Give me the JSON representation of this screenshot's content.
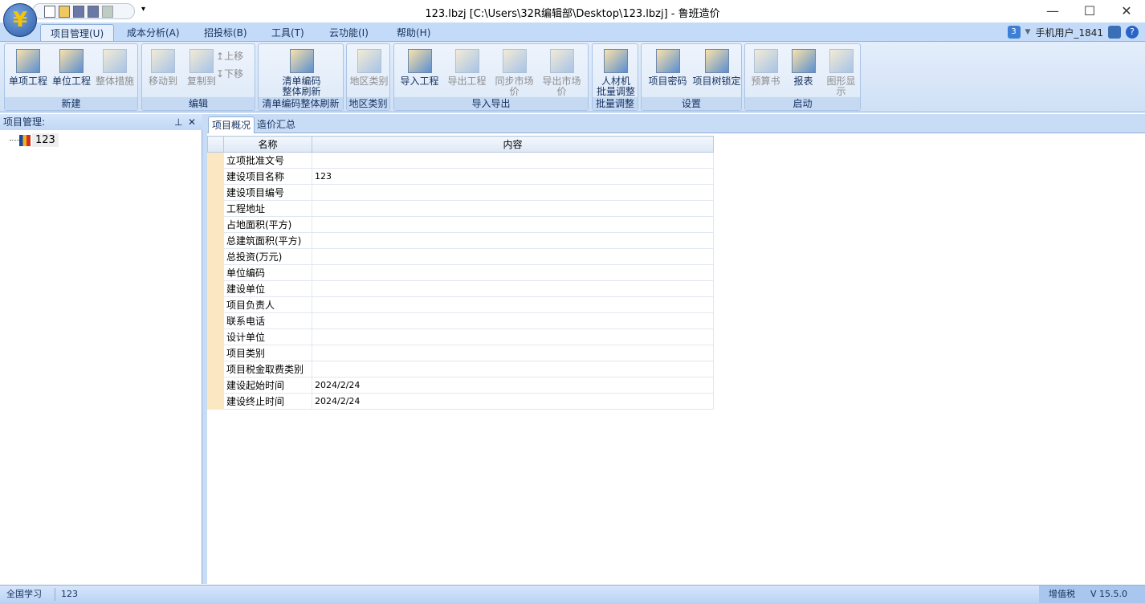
{
  "window": {
    "title": "123.lbzj [C:\\Users\\32R编辑部\\Desktop\\123.lbzj] - 鲁班造价",
    "logo": "¥"
  },
  "menu": [
    "项目管理(U)",
    "成本分析(A)",
    "招投标(B)",
    "工具(T)",
    "云功能(I)",
    "帮助(H)"
  ],
  "user": {
    "cloud_badge": "3",
    "name": "手机用户_1841"
  },
  "ribbon": {
    "groups": [
      {
        "label": "新建",
        "buttons": [
          {
            "label": "单项工程",
            "enabled": true
          },
          {
            "label": "单位工程",
            "enabled": true
          },
          {
            "label": "整体措施",
            "enabled": false
          }
        ]
      },
      {
        "label": "编辑",
        "buttons": [
          {
            "label": "移动到",
            "enabled": false
          },
          {
            "label": "复制到",
            "enabled": false
          }
        ],
        "small": [
          {
            "label": "上移",
            "icon": "↥"
          },
          {
            "label": "下移",
            "icon": "↧"
          }
        ]
      },
      {
        "label": "清单编码整体刷新",
        "buttons": [
          {
            "label": "清单编码\n整体刷新",
            "enabled": true
          }
        ]
      },
      {
        "label": "地区类别",
        "buttons": [
          {
            "label": "地区类别",
            "enabled": false
          }
        ]
      },
      {
        "label": "导入导出",
        "buttons": [
          {
            "label": "导入工程",
            "enabled": true
          },
          {
            "label": "导出工程",
            "enabled": false
          },
          {
            "label": "同步市场价",
            "enabled": false
          },
          {
            "label": "导出市场价",
            "enabled": false
          }
        ]
      },
      {
        "label": "批量调整",
        "buttons": [
          {
            "label": "人材机\n批量调整",
            "enabled": true
          }
        ]
      },
      {
        "label": "设置",
        "buttons": [
          {
            "label": "项目密码",
            "enabled": true
          },
          {
            "label": "项目树锁定",
            "enabled": true
          }
        ]
      },
      {
        "label": "启动",
        "buttons": [
          {
            "label": "预算书",
            "enabled": false
          },
          {
            "label": "报表",
            "enabled": true
          },
          {
            "label": "图形显示",
            "enabled": false
          }
        ]
      }
    ]
  },
  "left_panel": {
    "title": "项目管理:",
    "tree": [
      {
        "label": "123"
      }
    ]
  },
  "tabs": [
    "项目概况",
    "造价汇总"
  ],
  "table": {
    "headers": [
      "名称",
      "内容"
    ],
    "rows": [
      [
        "立项批准文号",
        ""
      ],
      [
        "建设项目名称",
        "123"
      ],
      [
        "建设项目编号",
        ""
      ],
      [
        "工程地址",
        ""
      ],
      [
        "占地面积(平方)",
        ""
      ],
      [
        "总建筑面积(平方)",
        ""
      ],
      [
        "总投资(万元)",
        ""
      ],
      [
        "单位编码",
        ""
      ],
      [
        "建设单位",
        ""
      ],
      [
        "项目负责人",
        ""
      ],
      [
        "联系电话",
        ""
      ],
      [
        "设计单位",
        ""
      ],
      [
        "项目类别",
        ""
      ],
      [
        "项目税金取费类别",
        ""
      ],
      [
        "建设起始时间",
        "2024/2/24"
      ],
      [
        "建设终止时间",
        "2024/2/24"
      ]
    ]
  },
  "status": {
    "left": "全国学习",
    "project": "123",
    "tax": "增值税",
    "version": "V 15.5.0"
  }
}
